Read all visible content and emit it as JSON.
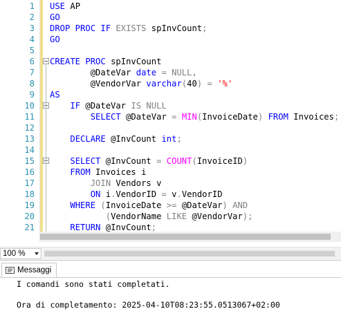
{
  "editor": {
    "lines": [
      {
        "n": "1",
        "fold": false,
        "tokens": [
          {
            "c": "kw",
            "t": "USE "
          },
          {
            "c": "tx",
            "t": "AP"
          }
        ]
      },
      {
        "n": "2",
        "fold": false,
        "tokens": [
          {
            "c": "kw",
            "t": "GO"
          }
        ]
      },
      {
        "n": "3",
        "fold": false,
        "tokens": [
          {
            "c": "kw",
            "t": "DROP PROC IF "
          },
          {
            "c": "op",
            "t": "EXISTS "
          },
          {
            "c": "tx",
            "t": "spInvCount"
          },
          {
            "c": "op",
            "t": ";"
          }
        ]
      },
      {
        "n": "4",
        "fold": false,
        "tokens": [
          {
            "c": "kw",
            "t": "GO"
          }
        ]
      },
      {
        "n": "5",
        "fold": false,
        "tokens": []
      },
      {
        "n": "6",
        "fold": true,
        "tokens": [
          {
            "c": "kw",
            "t": "CREATE PROC "
          },
          {
            "c": "tx",
            "t": "spInvCount"
          }
        ]
      },
      {
        "n": "7",
        "fold": false,
        "tokens": [
          {
            "c": "tx",
            "t": "        @DateVar "
          },
          {
            "c": "kw",
            "t": "date "
          },
          {
            "c": "op",
            "t": "= NULL,"
          }
        ]
      },
      {
        "n": "8",
        "fold": false,
        "tokens": [
          {
            "c": "tx",
            "t": "        @VendorVar "
          },
          {
            "c": "kw",
            "t": "varchar"
          },
          {
            "c": "op",
            "t": "("
          },
          {
            "c": "tx",
            "t": "40"
          },
          {
            "c": "op",
            "t": ") = "
          },
          {
            "c": "str",
            "t": "'%'"
          }
        ]
      },
      {
        "n": "9",
        "fold": false,
        "tokens": [
          {
            "c": "kw",
            "t": "AS"
          }
        ]
      },
      {
        "n": "10",
        "fold": true,
        "tokens": [
          {
            "c": "tx",
            "t": "    "
          },
          {
            "c": "kw",
            "t": "IF "
          },
          {
            "c": "tx",
            "t": "@DateVar "
          },
          {
            "c": "op",
            "t": "IS NULL"
          }
        ]
      },
      {
        "n": "11",
        "fold": false,
        "tokens": [
          {
            "c": "tx",
            "t": "        "
          },
          {
            "c": "kw",
            "t": "SELECT "
          },
          {
            "c": "tx",
            "t": "@DateVar "
          },
          {
            "c": "op",
            "t": "= "
          },
          {
            "c": "fn",
            "t": "MIN"
          },
          {
            "c": "op",
            "t": "("
          },
          {
            "c": "tx",
            "t": "InvoiceDate"
          },
          {
            "c": "op",
            "t": ") "
          },
          {
            "c": "kw",
            "t": "FROM "
          },
          {
            "c": "tx",
            "t": "Invoices"
          },
          {
            "c": "op",
            "t": ";"
          }
        ]
      },
      {
        "n": "12",
        "fold": false,
        "tokens": []
      },
      {
        "n": "13",
        "fold": false,
        "tokens": [
          {
            "c": "tx",
            "t": "    "
          },
          {
            "c": "kw",
            "t": "DECLARE "
          },
          {
            "c": "tx",
            "t": "@InvCount "
          },
          {
            "c": "kw",
            "t": "int"
          },
          {
            "c": "op",
            "t": ";"
          }
        ]
      },
      {
        "n": "14",
        "fold": false,
        "tokens": []
      },
      {
        "n": "15",
        "fold": true,
        "tokens": [
          {
            "c": "tx",
            "t": "    "
          },
          {
            "c": "kw",
            "t": "SELECT "
          },
          {
            "c": "tx",
            "t": "@InvCount "
          },
          {
            "c": "op",
            "t": "= "
          },
          {
            "c": "fn",
            "t": "COUNT"
          },
          {
            "c": "op",
            "t": "("
          },
          {
            "c": "tx",
            "t": "InvoiceID"
          },
          {
            "c": "op",
            "t": ")"
          }
        ]
      },
      {
        "n": "16",
        "fold": false,
        "tokens": [
          {
            "c": "tx",
            "t": "    "
          },
          {
            "c": "kw",
            "t": "FROM "
          },
          {
            "c": "tx",
            "t": "Invoices i"
          }
        ]
      },
      {
        "n": "17",
        "fold": false,
        "tokens": [
          {
            "c": "tx",
            "t": "        "
          },
          {
            "c": "op",
            "t": "JOIN "
          },
          {
            "c": "tx",
            "t": "Vendors v"
          }
        ]
      },
      {
        "n": "18",
        "fold": false,
        "tokens": [
          {
            "c": "tx",
            "t": "        "
          },
          {
            "c": "kw",
            "t": "ON "
          },
          {
            "c": "tx",
            "t": "i"
          },
          {
            "c": "op",
            "t": "."
          },
          {
            "c": "tx",
            "t": "VendorID "
          },
          {
            "c": "op",
            "t": "= "
          },
          {
            "c": "tx",
            "t": "v"
          },
          {
            "c": "op",
            "t": "."
          },
          {
            "c": "tx",
            "t": "VendorID"
          }
        ]
      },
      {
        "n": "19",
        "fold": false,
        "tokens": [
          {
            "c": "tx",
            "t": "    "
          },
          {
            "c": "kw",
            "t": "WHERE "
          },
          {
            "c": "op",
            "t": "("
          },
          {
            "c": "tx",
            "t": "InvoiceDate "
          },
          {
            "c": "op",
            "t": ">= "
          },
          {
            "c": "tx",
            "t": "@DateVar"
          },
          {
            "c": "op",
            "t": ") AND"
          }
        ]
      },
      {
        "n": "20",
        "fold": false,
        "tokens": [
          {
            "c": "tx",
            "t": "           "
          },
          {
            "c": "op",
            "t": "("
          },
          {
            "c": "tx",
            "t": "VendorName "
          },
          {
            "c": "op",
            "t": "LIKE "
          },
          {
            "c": "tx",
            "t": "@VendorVar"
          },
          {
            "c": "op",
            "t": ");"
          }
        ]
      },
      {
        "n": "21",
        "fold": false,
        "tokens": [
          {
            "c": "tx",
            "t": "    "
          },
          {
            "c": "kw",
            "t": "RETURN "
          },
          {
            "c": "tx",
            "t": "@InvCount"
          },
          {
            "c": "op",
            "t": ";"
          }
        ]
      }
    ]
  },
  "zoom": {
    "value": "100 %"
  },
  "results": {
    "tab_label": "Messaggi",
    "messages": [
      "I comandi sono stati completati.",
      "Ora di completamento: 2025-04-10T08:23:55.0513067+02:00"
    ]
  },
  "colors": {
    "keyword": "#0000ff",
    "function": "#ff00ff",
    "operator": "#808080",
    "string": "#ff0000",
    "line_number": "#2b91af",
    "change_bar": "#f0e08c"
  }
}
